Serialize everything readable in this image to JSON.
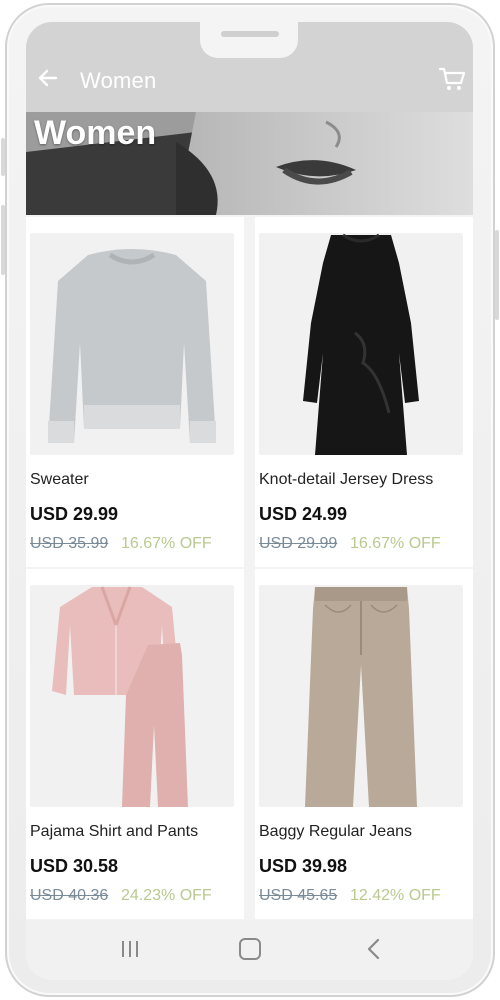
{
  "appbar": {
    "title": "Women"
  },
  "banner": {
    "title": "Women"
  },
  "colors": {
    "appbar": "#d3d3d3",
    "discount": "#b9c98f",
    "strike": "#7a8b98"
  },
  "products": [
    {
      "name": "Sweater",
      "price": "USD 29.99",
      "original_price": "USD 35.99",
      "discount": "16.67% OFF",
      "image": "grey-sweater"
    },
    {
      "name": "Knot-detail Jersey Dress",
      "price": "USD 24.99",
      "original_price": "USD 29.99",
      "discount": "16.67% OFF",
      "image": "black-dress"
    },
    {
      "name": "Pajama Shirt and Pants",
      "price": "USD 30.58",
      "original_price": "USD 40.36",
      "discount": "24.23% OFF",
      "image": "pink-pajamas"
    },
    {
      "name": "Baggy Regular Jeans",
      "price": "USD 39.98",
      "original_price": "USD 45.65",
      "discount": "12.42% OFF",
      "image": "beige-jeans"
    }
  ],
  "navbar": {
    "icons": [
      "recent-apps-icon",
      "home-icon",
      "back-icon"
    ]
  }
}
